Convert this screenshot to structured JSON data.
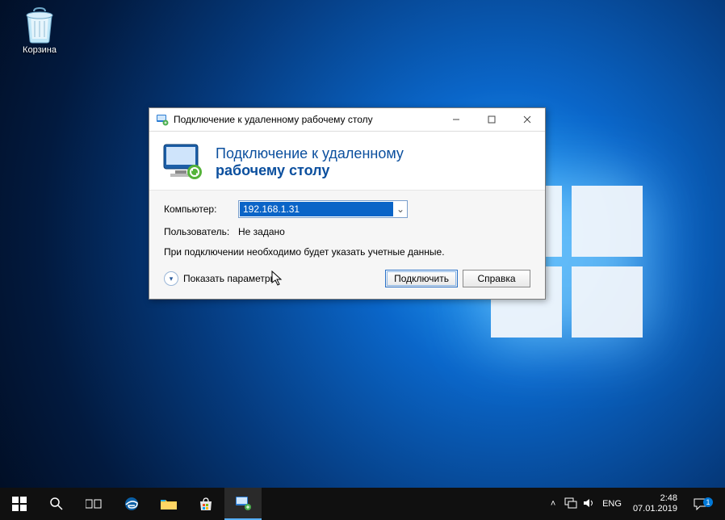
{
  "desktop": {
    "recycle_bin_label": "Корзина"
  },
  "dialog": {
    "title": "Подключение к удаленному рабочему столу",
    "heading_line1": "Подключение к удаленному",
    "heading_line2": "рабочему столу",
    "computer_label": "Компьютер:",
    "computer_value": "192.168.1.31",
    "user_label": "Пользователь:",
    "user_value": "Не задано",
    "hint": "При подключении необходимо будет указать учетные данные.",
    "show_options": "Показать параметры",
    "connect_btn": "Подключить",
    "help_btn": "Справка"
  },
  "taskbar": {
    "lang": "ENG",
    "time": "2:48",
    "date": "07.01.2019",
    "notif_count": "1"
  }
}
